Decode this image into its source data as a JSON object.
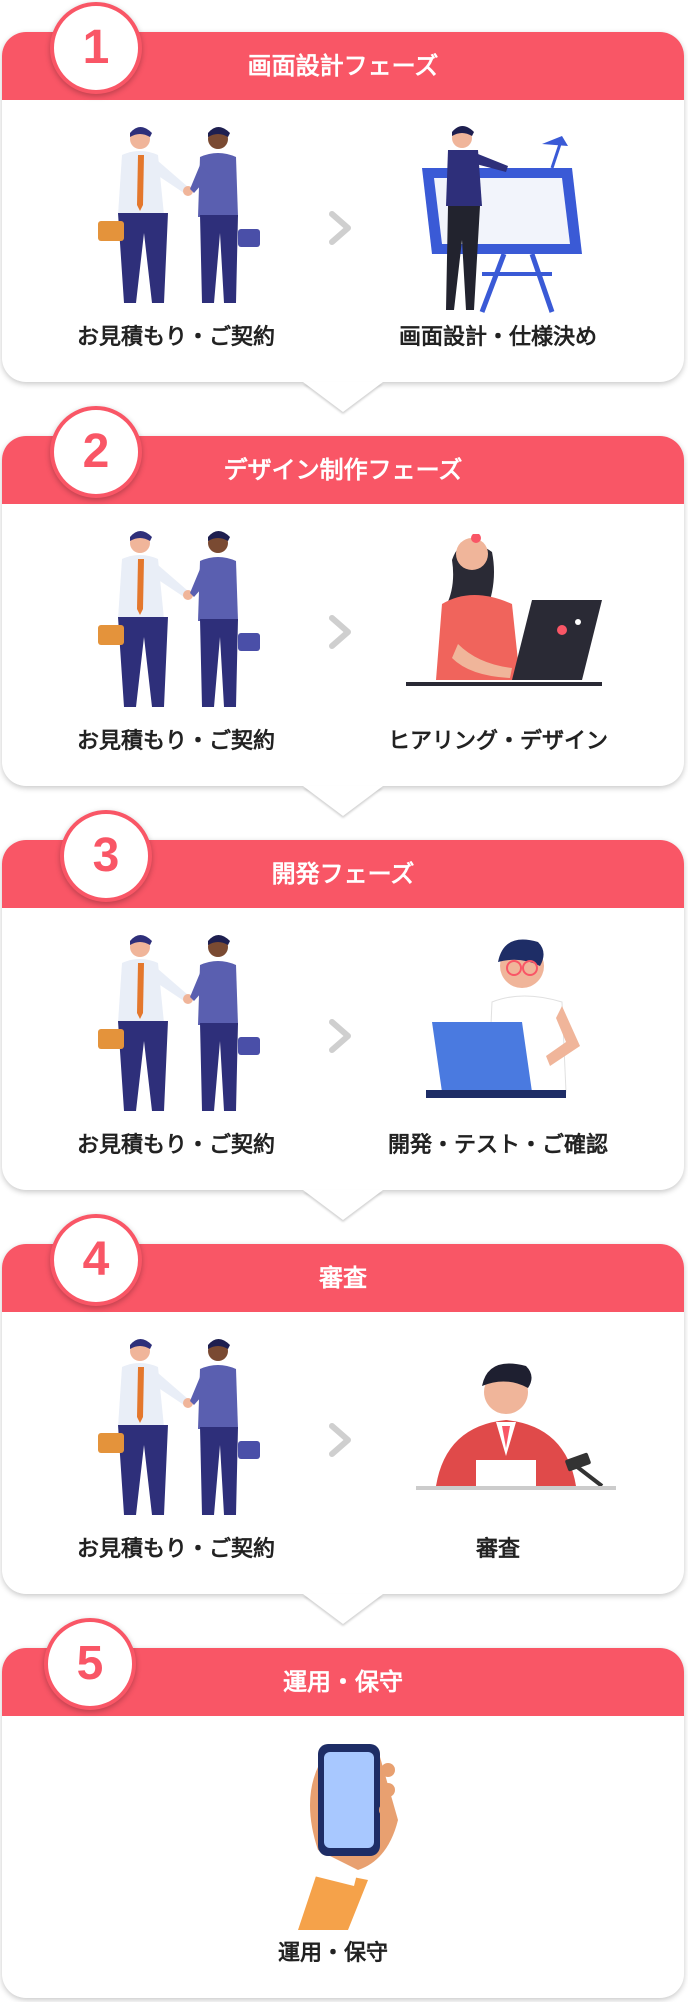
{
  "colors": {
    "accent": "#f95666",
    "figure": "#2e2f7a",
    "shirt": "#e9eef7",
    "tie": "#e4772c"
  },
  "phases": [
    {
      "number": "1",
      "title": "画面設計フェーズ",
      "left_label": "お見積もり・ご契約",
      "right_label": "画面設計・仕様決め",
      "right_icon": "designer-drafting-table-icon"
    },
    {
      "number": "2",
      "title": "デザイン制作フェーズ",
      "left_label": "お見積もり・ご契約",
      "right_label": "ヒアリング・デザイン",
      "right_icon": "woman-laptop-icon"
    },
    {
      "number": "3",
      "title": "開発フェーズ",
      "left_label": "お見積もり・ご契約",
      "right_label": "開発・テスト・ご確認",
      "right_icon": "developer-laptop-icon"
    },
    {
      "number": "4",
      "title": "審査",
      "left_label": "お見積もり・ご契約",
      "right_label": "審査",
      "right_icon": "judge-gavel-icon"
    },
    {
      "number": "5",
      "title": "運用・保守",
      "center_label": "運用・保守",
      "center_icon": "hand-smartphone-icon"
    }
  ],
  "left_icon": "handshake-icon"
}
